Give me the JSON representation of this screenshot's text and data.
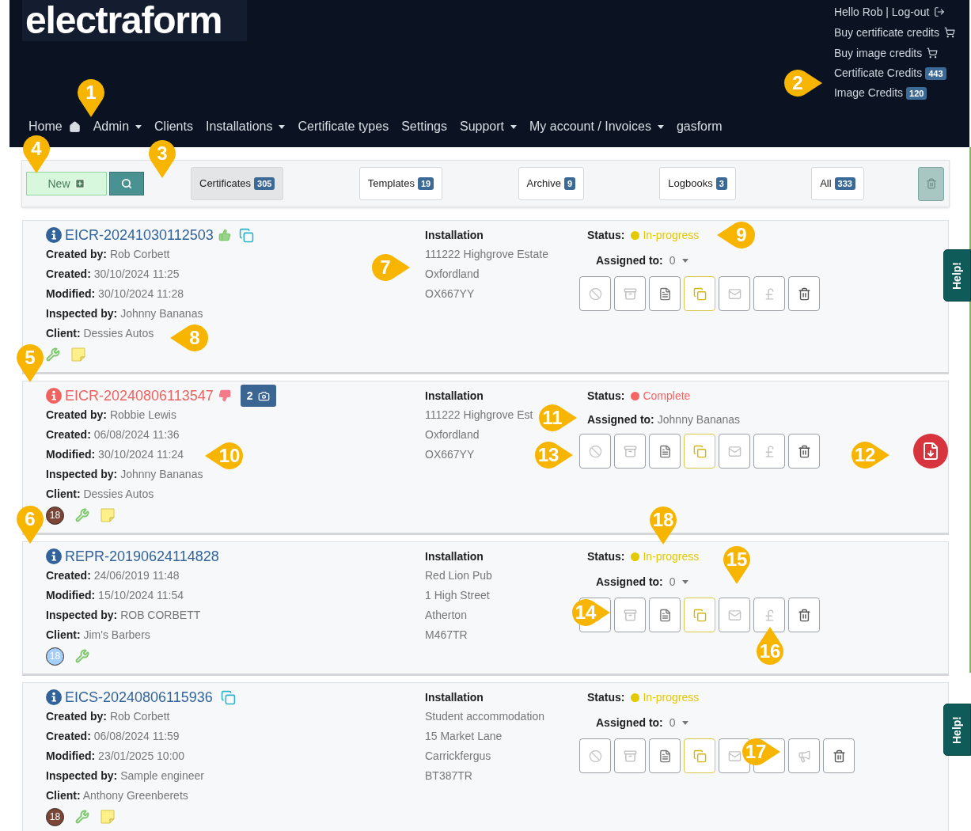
{
  "header": {
    "logo": "electraform",
    "account_links": [
      "Hello Rob | Log-out",
      "Buy certificate credits",
      "Buy image credits"
    ],
    "credits": [
      {
        "label": "Certificate Credits",
        "count": "443"
      },
      {
        "label": "Image Credits",
        "count": "120"
      }
    ],
    "nav": [
      {
        "label": "Home",
        "home_icon": true,
        "dropdown": false
      },
      {
        "label": "Admin",
        "dropdown": true
      },
      {
        "label": "Clients",
        "dropdown": false
      },
      {
        "label": "Installations",
        "dropdown": true
      },
      {
        "label": "Certificate types",
        "dropdown": false
      },
      {
        "label": "Settings",
        "dropdown": false
      },
      {
        "label": "Support",
        "dropdown": true
      },
      {
        "label": "My account / Invoices",
        "dropdown": true
      },
      {
        "label": "gasform",
        "dropdown": false
      }
    ]
  },
  "toolbar": {
    "new_label": "New",
    "tabs": [
      {
        "label": "Certificates",
        "count": "305",
        "selected": true
      },
      {
        "label": "Templates",
        "count": "19",
        "selected": false
      },
      {
        "label": "Archive",
        "count": "9",
        "selected": false
      },
      {
        "label": "Logbooks",
        "count": "3",
        "selected": false
      },
      {
        "label": "All",
        "count": "333",
        "selected": false
      }
    ]
  },
  "cards": [
    {
      "id": "EICR-20241030112503",
      "thumbs_up": true,
      "copy_icon": true,
      "fields": [
        {
          "label": "Created by:",
          "value": "Rob Corbett"
        },
        {
          "label": "Created:",
          "value": "30/10/2024 11:25"
        },
        {
          "label": "Modified:",
          "value": "30/10/2024 11:28"
        },
        {
          "label": "Inspected by:",
          "value": "Johnny Bananas"
        },
        {
          "label": "Client:",
          "value": "Dessies Autos"
        }
      ],
      "installation": {
        "heading": "Installation",
        "lines": [
          "111222 Highgrove Estate",
          "Oxfordland",
          "OX667YY"
        ]
      },
      "status": {
        "label": "Status:",
        "kind": "in_progress",
        "text": "In-progress",
        "color": "#e3c900"
      },
      "assigned": {
        "label": "Assigned to:",
        "value": "0",
        "dropdown": true
      },
      "actions": [
        {
          "kind": "block"
        },
        {
          "kind": "archive"
        },
        {
          "kind": "document"
        },
        {
          "kind": "copy"
        },
        {
          "kind": "mail"
        },
        {
          "kind": "pound"
        },
        {
          "kind": "trash"
        }
      ],
      "pdf": false,
      "footer": [
        {
          "kind": "wrench"
        },
        {
          "kind": "note"
        }
      ]
    },
    {
      "id": "EICR-20240806113547",
      "thumbs_up": false,
      "photo_count": "2",
      "fields": [
        {
          "label": "Created by:",
          "value": "Robbie Lewis"
        },
        {
          "label": "Created:",
          "value": "06/08/2024 11:36"
        },
        {
          "label": "Modified:",
          "value": "30/10/2024 11:24"
        },
        {
          "label": "Inspected by:",
          "value": "Johnny Bananas"
        },
        {
          "label": "Client:",
          "value": "Dessies Autos"
        }
      ],
      "installation": {
        "heading": "Installation",
        "lines": [
          "111222 Highgrove Est",
          "Oxfordland",
          "OX667YY"
        ]
      },
      "status": {
        "label": "Status:",
        "kind": "complete",
        "text": "Complete",
        "color": "#f66464"
      },
      "assigned": {
        "label": "Assigned to:",
        "value": "Johnny Bananas",
        "dropdown": false
      },
      "actions": [
        {
          "kind": "block"
        },
        {
          "kind": "archive"
        },
        {
          "kind": "document"
        },
        {
          "kind": "copy"
        },
        {
          "kind": "mail"
        },
        {
          "kind": "pound"
        },
        {
          "kind": "trash"
        }
      ],
      "pdf": true,
      "footer": [
        {
          "kind": "badge",
          "text": "18",
          "color": "#7b4636"
        },
        {
          "kind": "wrench"
        },
        {
          "kind": "note"
        }
      ]
    },
    {
      "id": "REPR-20190624114828",
      "fields": [
        {
          "label": "Created:",
          "value": "24/06/2019 11:48"
        },
        {
          "label": "Modified:",
          "value": "15/10/2024 11:54"
        },
        {
          "label": "Inspected by:",
          "value": "ROB CORBETT"
        },
        {
          "label": "Client:",
          "value": "Jim's Barbers"
        }
      ],
      "installation": {
        "heading": "Installation",
        "lines": [
          "Red Lion Pub",
          "1 High Street",
          "Atherton",
          "M467TR"
        ]
      },
      "status": {
        "label": "Status:",
        "kind": "in_progress",
        "text": "In-progress",
        "color": "#e3c900"
      },
      "assigned": {
        "label": "Assigned to:",
        "value": "0",
        "dropdown": true
      },
      "actions": [
        {
          "kind": "block"
        },
        {
          "kind": "archive"
        },
        {
          "kind": "document"
        },
        {
          "kind": "copy"
        },
        {
          "kind": "mail"
        },
        {
          "kind": "pound"
        },
        {
          "kind": "trash"
        }
      ],
      "pdf": false,
      "footer": [
        {
          "kind": "badge",
          "text": "18",
          "color": "#a3cffa"
        },
        {
          "kind": "wrench"
        }
      ]
    },
    {
      "id": "EICS-20240806115936",
      "copy_icon": true,
      "fields": [
        {
          "label": "Created by:",
          "value": "Rob Corbett"
        },
        {
          "label": "Created:",
          "value": "06/08/2024 11:59"
        },
        {
          "label": "Modified:",
          "value": "23/01/2025 10:00"
        },
        {
          "label": "Inspected by:",
          "value": "Sample engineer"
        },
        {
          "label": "Client:",
          "value": "Anthony Greenberets"
        }
      ],
      "installation": {
        "heading": "Installation",
        "lines": [
          "Student accommodation",
          "15 Market Lane",
          "Carrickfergus",
          "BT387TR"
        ]
      },
      "status": {
        "label": "Status:",
        "kind": "in_progress",
        "text": "In-progress",
        "color": "#e3c900"
      },
      "assigned": {
        "label": "Assigned to:",
        "value": "0",
        "dropdown": true
      },
      "actions": [
        {
          "kind": "block"
        },
        {
          "kind": "archive"
        },
        {
          "kind": "document"
        },
        {
          "kind": "copy"
        },
        {
          "kind": "mail"
        },
        {
          "kind": "blank"
        },
        {
          "kind": "megaphone"
        },
        {
          "kind": "trash"
        }
      ],
      "pdf": false,
      "footer": [
        {
          "kind": "badge",
          "text": "18",
          "color": "#7b4636"
        },
        {
          "kind": "wrench"
        },
        {
          "kind": "note"
        }
      ]
    }
  ],
  "help_tabs": [
    "Help!",
    "Help!"
  ],
  "callouts": [
    "1",
    "2",
    "4",
    "3",
    "9",
    "7",
    "5",
    "8",
    "11",
    "10",
    "13",
    "12",
    "6",
    "18",
    "15",
    "14",
    "16",
    "17"
  ]
}
